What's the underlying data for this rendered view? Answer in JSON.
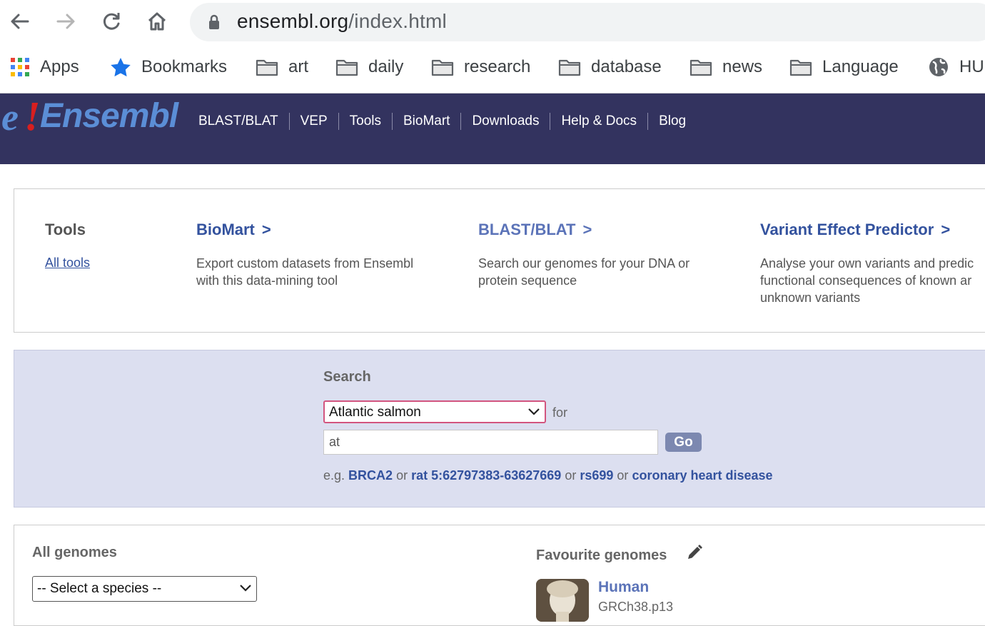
{
  "browser": {
    "url_host": "ensembl.org",
    "url_path": "/index.html",
    "bookmarks": [
      {
        "label": "Apps",
        "icon": "apps-grid-icon"
      },
      {
        "label": "Bookmarks",
        "icon": "star-icon"
      },
      {
        "label": "art",
        "icon": "folder-icon"
      },
      {
        "label": "daily",
        "icon": "folder-icon"
      },
      {
        "label": "research",
        "icon": "folder-icon"
      },
      {
        "label": "database",
        "icon": "folder-icon"
      },
      {
        "label": "news",
        "icon": "folder-icon"
      },
      {
        "label": "Language",
        "icon": "folder-icon"
      },
      {
        "label": "HU",
        "icon": "globe-icon"
      }
    ]
  },
  "masthead": {
    "logo_text": "Ensembl",
    "nav": [
      "BLAST/BLAT",
      "VEP",
      "Tools",
      "BioMart",
      "Downloads",
      "Help & Docs",
      "Blog"
    ],
    "color": "#33335f"
  },
  "tools": {
    "title": "Tools",
    "all_tools_label": "All tools",
    "items": [
      {
        "name": "BioMart",
        "arrow": ">",
        "desc": [
          "Export custom datasets from Ensembl",
          "with this data-mining tool"
        ]
      },
      {
        "name": "BLAST/BLAT",
        "arrow": ">",
        "desc": [
          "Search our genomes for your DNA or",
          "protein sequence"
        ]
      },
      {
        "name": "Variant Effect Predictor",
        "arrow": ">",
        "desc": [
          "Analyse your own variants and predic",
          "functional consequences of known ar",
          "unknown variants"
        ]
      }
    ]
  },
  "search": {
    "title": "Search",
    "species_value": "Atlantic salmon",
    "for_label": "for",
    "query_value": "at",
    "go_label": "Go",
    "eg_label": "e.g.",
    "or_label": "or",
    "examples": [
      "BRCA2",
      "rat 5:62797383-63627669",
      "rs699",
      "coronary heart disease"
    ]
  },
  "genomes": {
    "all_title": "All genomes",
    "select_placeholder": "-- Select a species --",
    "fav_title": "Favourite genomes",
    "favourites": [
      {
        "name": "Human",
        "assembly": "GRCh38.p13"
      }
    ]
  }
}
